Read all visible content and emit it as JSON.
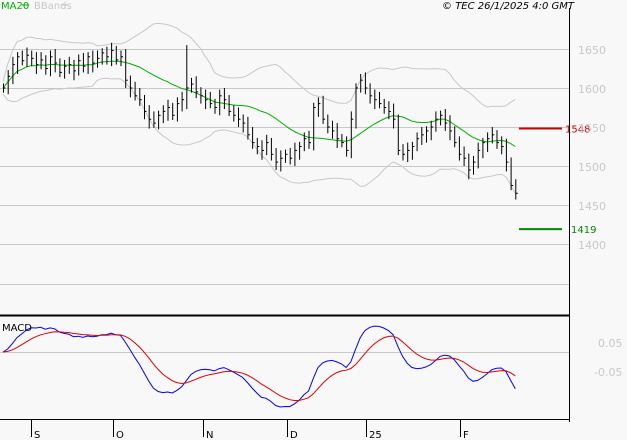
{
  "header": {
    "legend_ma": "MA20",
    "legend_bb": "BBands",
    "copyright": "© TEC 26/1/2025 4:0 GMT"
  },
  "colors": {
    "ma": "#00b000",
    "bbands": "#c8c8c8",
    "macd": "#0000ff",
    "signal": "#e00000",
    "resistance": "#cc0000",
    "support": "#008800"
  },
  "chart_data": [
    {
      "type": "ohlc",
      "title": "",
      "indicators": [
        "MA20",
        "BBands"
      ],
      "ylim": [
        1350,
        1700
      ],
      "y_ticks": [
        "1650",
        "1600",
        "1550",
        "1500",
        "1450",
        "1400"
      ],
      "y_tick_values": [
        1650,
        1600,
        1550,
        1500,
        1450,
        1400
      ],
      "closes": [
        1600,
        1615,
        1630,
        1640,
        1635,
        1642,
        1638,
        1630,
        1636,
        1625,
        1640,
        1632,
        1620,
        1628,
        1630,
        1622,
        1635,
        1628,
        1640,
        1632,
        1638,
        1645,
        1640,
        1648,
        1636,
        1640,
        1610,
        1600,
        1590,
        1585,
        1570,
        1560,
        1555,
        1565,
        1570,
        1575,
        1565,
        1580,
        1585,
        1600,
        1605,
        1595,
        1590,
        1585,
        1580,
        1575,
        1590,
        1585,
        1570,
        1565,
        1560,
        1555,
        1540,
        1530,
        1525,
        1520,
        1530,
        1515,
        1505,
        1510,
        1515,
        1510,
        1520,
        1525,
        1535,
        1530,
        1575,
        1580,
        1560,
        1550,
        1545,
        1535,
        1530,
        1520,
        1560,
        1600,
        1610,
        1600,
        1590,
        1585,
        1580,
        1575,
        1570,
        1560,
        1520,
        1515,
        1520,
        1525,
        1535,
        1540,
        1545,
        1550,
        1560,
        1565,
        1555,
        1545,
        1530,
        1515,
        1510,
        1495,
        1505,
        1520,
        1530,
        1535,
        1540,
        1530,
        1525,
        1505,
        1475,
        1465
      ],
      "resistance": {
        "value": 1548,
        "label": "1548"
      },
      "support": {
        "value": 1419,
        "label": "1419"
      },
      "x_ticks": [
        "S",
        "O",
        "N",
        "D",
        "25",
        "F"
      ]
    },
    {
      "type": "line",
      "title": "MACD",
      "series": [
        "MACD",
        "Signal"
      ],
      "y_ticks": [
        "0.05",
        "-0.05"
      ]
    }
  ]
}
